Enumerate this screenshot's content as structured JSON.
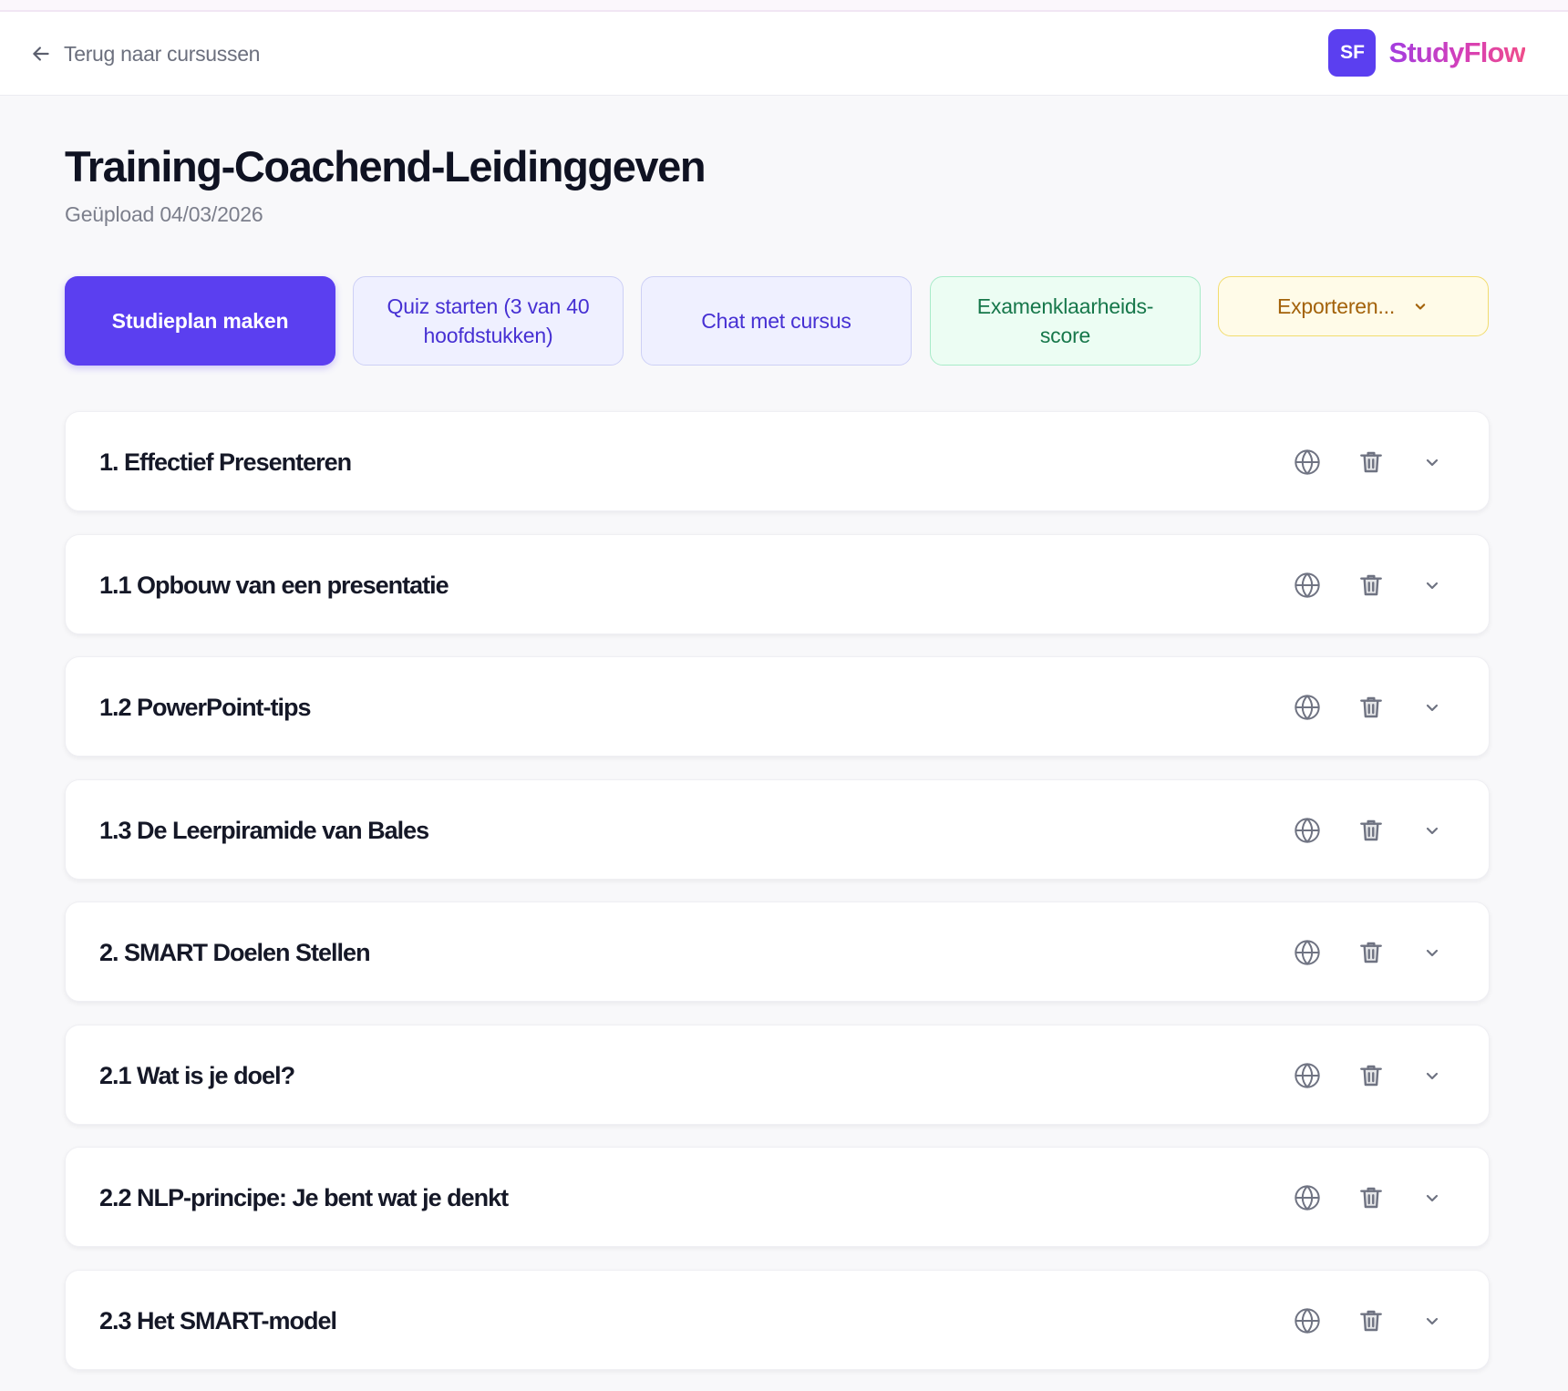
{
  "header": {
    "back_label": "Terug naar cursussen",
    "brand_logo": "SF",
    "brand_name": "StudyFlow",
    "brand_color": "#5b3ff0"
  },
  "course": {
    "title": "Training-Coachend-Leidinggeven",
    "uploaded": "Geüpload 04/03/2026"
  },
  "actions": {
    "study_plan": "Studieplan maken",
    "quiz": "Quiz starten (3 van 40 hoofdstukken)",
    "chat": "Chat met cursus",
    "exam_score": "Examenklaarheids-score",
    "export": "Exporteren..."
  },
  "chapters": [
    {
      "title": "1. Effectief Presenteren"
    },
    {
      "title": "1.1 Opbouw van een presentatie"
    },
    {
      "title": "1.2 PowerPoint-tips"
    },
    {
      "title": "1.3 De Leerpiramide van Bales"
    },
    {
      "title": "2. SMART Doelen Stellen"
    },
    {
      "title": "2.1 Wat is je doel?"
    },
    {
      "title": "2.2 NLP-principe: Je bent wat je denkt"
    },
    {
      "title": "2.3 Het SMART-model"
    }
  ],
  "icons": {
    "back": "arrow-left-icon",
    "translate": "globe-icon",
    "delete": "trash-icon",
    "expand": "chevron-down-icon"
  },
  "colors": {
    "primary": "#5b3ff0",
    "quiz_bg": "#eff0ff",
    "exam_bg": "#ecfdf3",
    "export_bg": "#fffbe8"
  }
}
